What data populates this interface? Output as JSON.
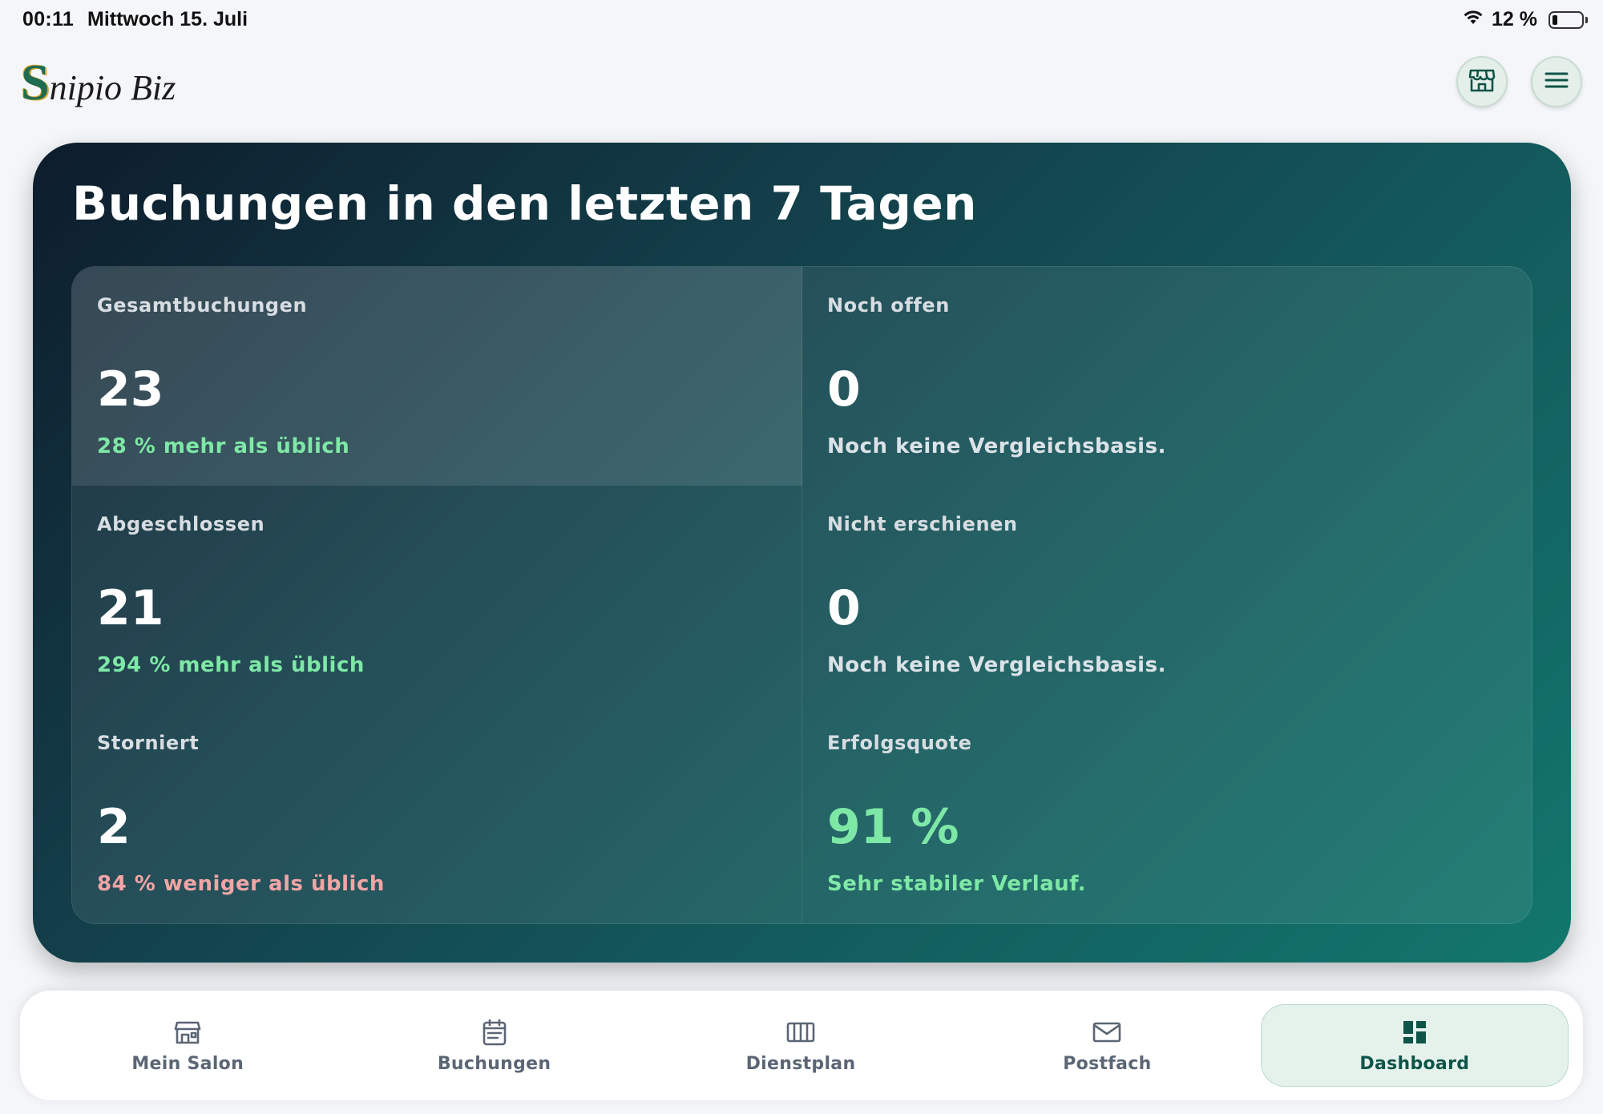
{
  "status_bar": {
    "time": "00:11",
    "date": "Mittwoch 15. Juli",
    "battery": "12 %",
    "wifi_icon": "wifi-icon",
    "battery_icon": "battery-icon"
  },
  "header": {
    "logo_initial": "S",
    "logo_rest": "nipio Biz",
    "store_icon": "store-icon",
    "menu_icon": "hamburger-menu-icon"
  },
  "card": {
    "title": "Buchungen in den letzten 7 Tagen",
    "stats": [
      {
        "label": "Gesamtbuchungen",
        "value": "23",
        "note": "28 % mehr als üblich",
        "note_tone": "positive"
      },
      {
        "label": "Noch offen",
        "value": "0",
        "note": "Noch keine Vergleichsbasis.",
        "note_tone": "neutral"
      },
      {
        "label": "Abgeschlossen",
        "value": "21",
        "note": "294 % mehr als üblich",
        "note_tone": "positive"
      },
      {
        "label": "Nicht erschienen",
        "value": "0",
        "note": "Noch keine Vergleichsbasis.",
        "note_tone": "neutral"
      },
      {
        "label": "Storniert",
        "value": "2",
        "note": "84 % weniger als üblich",
        "note_tone": "negative"
      },
      {
        "label": "Erfolgsquote",
        "value": "91 %",
        "note": "Sehr stabiler Verlauf.",
        "note_tone": "positive"
      }
    ]
  },
  "tabbar": {
    "tabs": [
      {
        "label": "Mein Salon",
        "icon": "storefront-icon",
        "active": false
      },
      {
        "label": "Buchungen",
        "icon": "calendar-icon",
        "active": false
      },
      {
        "label": "Dienstplan",
        "icon": "schedule-columns-icon",
        "active": false
      },
      {
        "label": "Postfach",
        "icon": "envelope-icon",
        "active": false
      },
      {
        "label": "Dashboard",
        "icon": "dashboard-icon",
        "active": true
      }
    ]
  },
  "colors": {
    "accent_positive": "#7ee8a6",
    "accent_negative": "#f2a5a5",
    "brand_green": "#0f5448",
    "card_gradient_start": "#0d1c2c",
    "card_gradient_end": "#12776d"
  }
}
